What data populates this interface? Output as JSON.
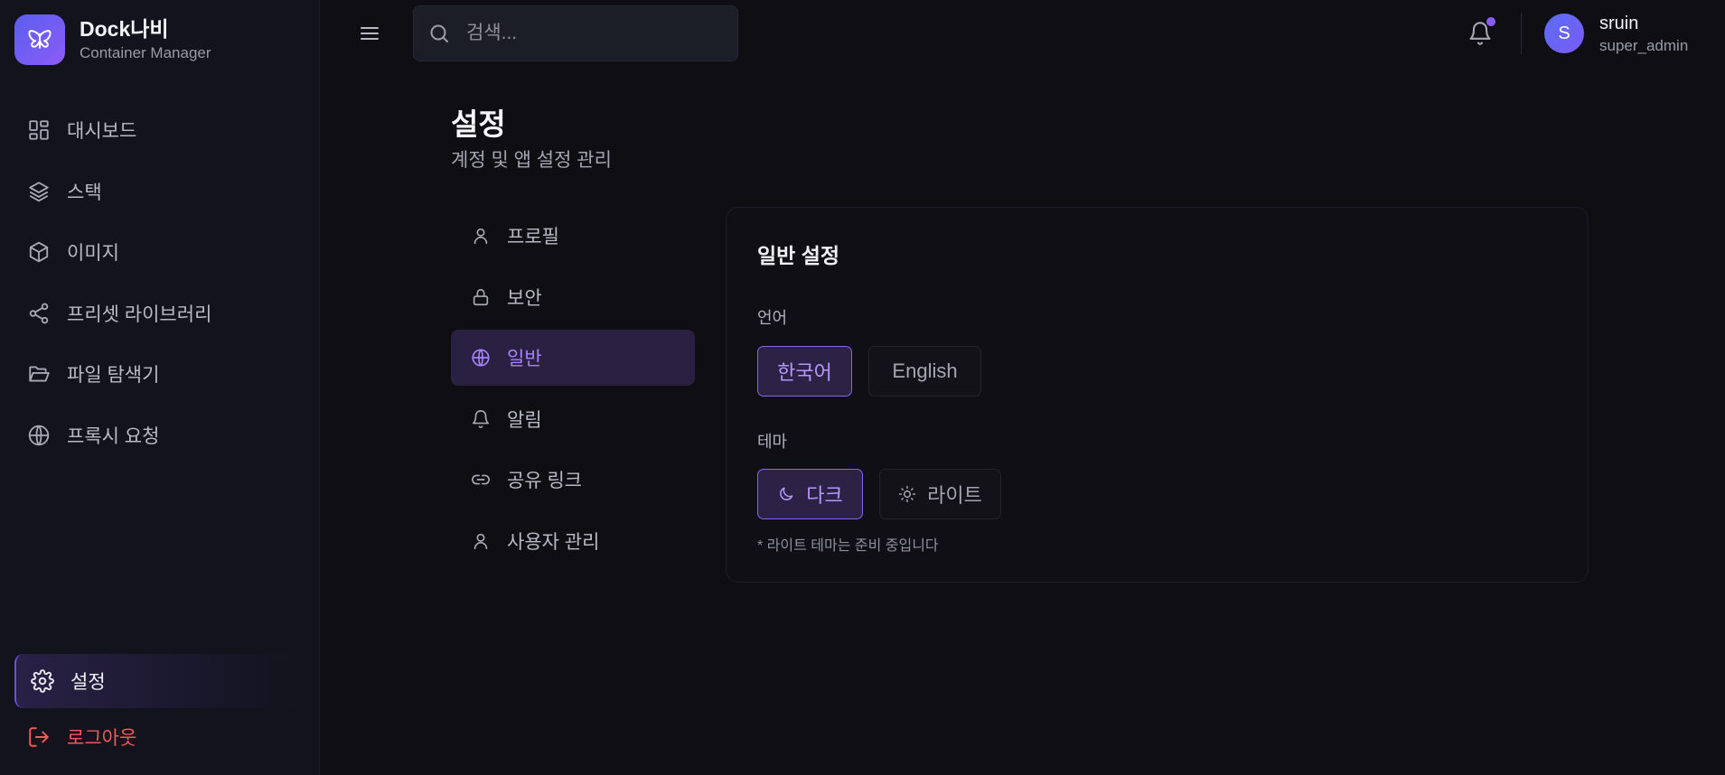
{
  "app": {
    "name": "Dock나비",
    "subtitle": "Container Manager"
  },
  "sidebar": {
    "items": [
      {
        "label": "대시보드",
        "icon": "dashboard-grid-icon"
      },
      {
        "label": "스택",
        "icon": "layers-icon"
      },
      {
        "label": "이미지",
        "icon": "cube-icon"
      },
      {
        "label": "프리셋 라이브러리",
        "icon": "share-nodes-icon"
      },
      {
        "label": "파일 탐색기",
        "icon": "folder-open-icon"
      },
      {
        "label": "프록시 요청",
        "icon": "globe-icon"
      }
    ],
    "settings_label": "설정",
    "logout_label": "로그아웃"
  },
  "topbar": {
    "search_placeholder": "검색...",
    "user_initial": "S",
    "user_name": "sruin",
    "user_role": "super_admin",
    "notification_dot": true
  },
  "page": {
    "title": "설정",
    "subtitle": "계정 및 앱 설정 관리"
  },
  "settings_nav": {
    "items": [
      {
        "label": "프로필",
        "icon": "user-icon"
      },
      {
        "label": "보안",
        "icon": "lock-icon"
      },
      {
        "label": "일반",
        "icon": "globe-icon",
        "active": true
      },
      {
        "label": "알림",
        "icon": "bell-icon"
      },
      {
        "label": "공유 링크",
        "icon": "link-icon"
      },
      {
        "label": "사용자 관리",
        "icon": "user-icon"
      }
    ]
  },
  "general": {
    "title": "일반 설정",
    "language_label": "언어",
    "language_options": [
      "한국어",
      "English"
    ],
    "language_selected": "한국어",
    "theme_label": "테마",
    "theme_options": [
      "다크",
      "라이트"
    ],
    "theme_selected": "다크",
    "theme_note": "* 라이트 테마는 준비 중입니다"
  },
  "colors": {
    "accent": "#8b5cf6",
    "danger": "#ef5a5a",
    "background": "#0e0e13",
    "sidebar": "#12131c"
  }
}
